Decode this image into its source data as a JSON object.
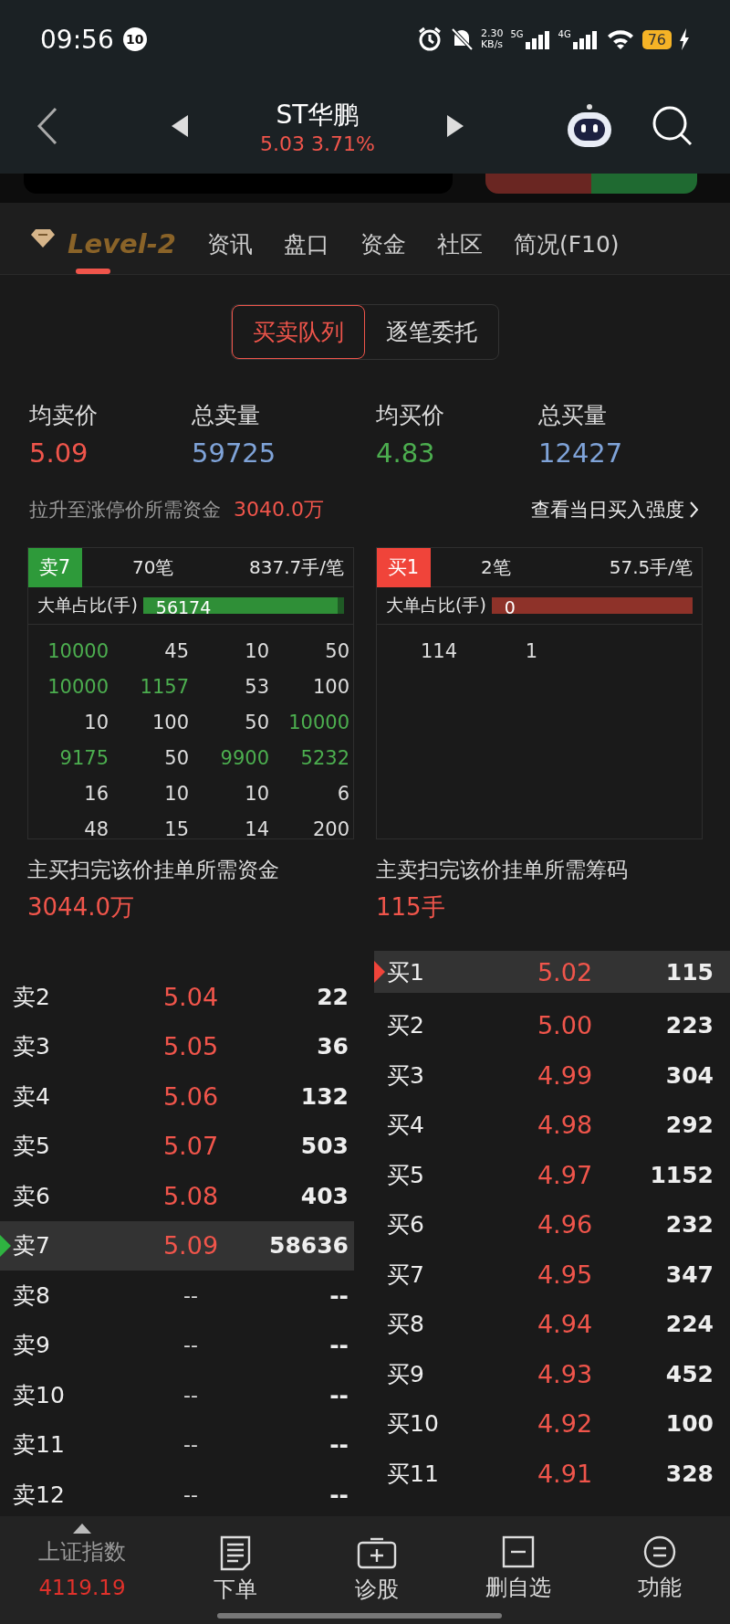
{
  "status_bar": {
    "time": "09:56",
    "notification_count": "10",
    "net_speed": "2.30",
    "net_unit": "KB/s",
    "signal_1": "5G",
    "signal_2": "4G",
    "battery": "76"
  },
  "header": {
    "title": "ST华鹏",
    "price": "5.03",
    "change": "3.71%"
  },
  "tabs": [
    {
      "label": "Level-2",
      "selected": true
    },
    {
      "label": "资讯",
      "selected": false
    },
    {
      "label": "盘口",
      "selected": false
    },
    {
      "label": "资金",
      "selected": false
    },
    {
      "label": "社区",
      "selected": false
    },
    {
      "label": "简况(F10)",
      "selected": false
    }
  ],
  "segments": [
    {
      "label": "买卖队列",
      "selected": true
    },
    {
      "label": "逐笔委托",
      "selected": false
    }
  ],
  "stats": [
    {
      "label": "均卖价",
      "value": "5.09",
      "color": "#f0554b"
    },
    {
      "label": "总卖量",
      "value": "59725",
      "color": "#7fa3d8"
    },
    {
      "label": "均买价",
      "value": "4.83",
      "color": "#4cae4f"
    },
    {
      "label": "总买量",
      "value": "12427",
      "color": "#7fa3d8"
    }
  ],
  "limit_up": {
    "label": "拉升至涨停价所需资金",
    "value": "3040.0万",
    "link": "查看当日买入强度"
  },
  "queues": [
    {
      "kind": "sell",
      "tag": "卖7",
      "count": "70笔",
      "average": "837.7手/笔",
      "big_label": "大单占比(手)",
      "big_value": "56174",
      "level": 0.97,
      "cells": [
        {
          "value": "10000",
          "large": true
        },
        {
          "value": "45",
          "large": false
        },
        {
          "value": "10",
          "large": false
        },
        {
          "value": "50",
          "large": false
        },
        {
          "value": "10000",
          "large": true
        },
        {
          "value": "1157",
          "large": true
        },
        {
          "value": "53",
          "large": false
        },
        {
          "value": "100",
          "large": false
        },
        {
          "value": "10",
          "large": false
        },
        {
          "value": "100",
          "large": false
        },
        {
          "value": "50",
          "large": false
        },
        {
          "value": "10000",
          "large": true
        },
        {
          "value": "9175",
          "large": true
        },
        {
          "value": "50",
          "large": false
        },
        {
          "value": "9900",
          "large": true
        },
        {
          "value": "5232",
          "large": true
        },
        {
          "value": "16",
          "large": false
        },
        {
          "value": "10",
          "large": false
        },
        {
          "value": "10",
          "large": false
        },
        {
          "value": "6",
          "large": false
        },
        {
          "value": "48",
          "large": false
        },
        {
          "value": "15",
          "large": false
        },
        {
          "value": "14",
          "large": false
        },
        {
          "value": "200",
          "large": false
        }
      ],
      "footer_label": "主买扫完该价挂单所需资金",
      "footer_value": "3044.0万"
    },
    {
      "kind": "buy",
      "tag": "买1",
      "count": "2笔",
      "average": "57.5手/笔",
      "big_label": "大单占比(手)",
      "big_value": "0",
      "level": 1,
      "cells": [
        {
          "value": "114",
          "large": false
        },
        {
          "value": "1",
          "large": false
        }
      ],
      "footer_label": "主卖扫完该价挂单所需筹码",
      "footer_value": "115手"
    }
  ],
  "order_book": {
    "sell": [
      {
        "label": "卖2",
        "price": "5.04",
        "volume": "22",
        "selected": false
      },
      {
        "label": "卖3",
        "price": "5.05",
        "volume": "36",
        "selected": false
      },
      {
        "label": "卖4",
        "price": "5.06",
        "volume": "132",
        "selected": false
      },
      {
        "label": "卖5",
        "price": "5.07",
        "volume": "503",
        "selected": false
      },
      {
        "label": "卖6",
        "price": "5.08",
        "volume": "403",
        "selected": false
      },
      {
        "label": "卖7",
        "price": "5.09",
        "volume": "58636",
        "selected": true
      },
      {
        "label": "卖8",
        "price": "--",
        "volume": "--",
        "selected": false
      },
      {
        "label": "卖9",
        "price": "--",
        "volume": "--",
        "selected": false
      },
      {
        "label": "卖10",
        "price": "--",
        "volume": "--",
        "selected": false
      },
      {
        "label": "卖11",
        "price": "--",
        "volume": "--",
        "selected": false
      },
      {
        "label": "卖12",
        "price": "--",
        "volume": "--",
        "selected": false
      }
    ],
    "buy": [
      {
        "label": "买1",
        "price": "5.02",
        "volume": "115",
        "selected": true
      },
      {
        "label": "买2",
        "price": "5.00",
        "volume": "223",
        "selected": false
      },
      {
        "label": "买3",
        "price": "4.99",
        "volume": "304",
        "selected": false
      },
      {
        "label": "买4",
        "price": "4.98",
        "volume": "292",
        "selected": false
      },
      {
        "label": "买5",
        "price": "4.97",
        "volume": "1152",
        "selected": false
      },
      {
        "label": "买6",
        "price": "4.96",
        "volume": "232",
        "selected": false
      },
      {
        "label": "买7",
        "price": "4.95",
        "volume": "347",
        "selected": false
      },
      {
        "label": "买8",
        "price": "4.94",
        "volume": "224",
        "selected": false
      },
      {
        "label": "买9",
        "price": "4.93",
        "volume": "452",
        "selected": false
      },
      {
        "label": "买10",
        "price": "4.92",
        "volume": "100",
        "selected": false
      },
      {
        "label": "买11",
        "price": "4.91",
        "volume": "328",
        "selected": false
      }
    ]
  },
  "bottom_nav": {
    "index_name": "上证指数",
    "index_value": "4119.19",
    "items": [
      {
        "kind": "order",
        "label": "下单"
      },
      {
        "kind": "diagnose",
        "label": "诊股"
      },
      {
        "kind": "remove",
        "label": "删自选"
      },
      {
        "kind": "menu",
        "label": "功能"
      }
    ]
  }
}
